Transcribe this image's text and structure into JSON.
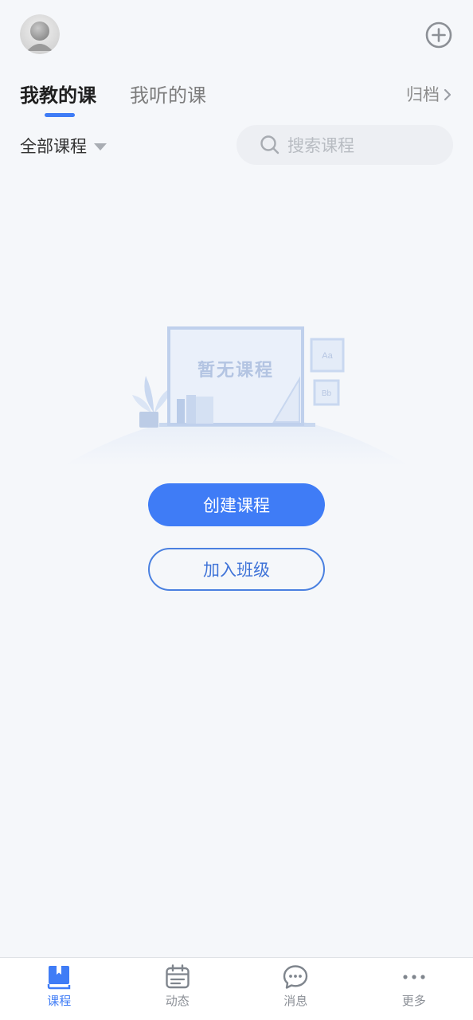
{
  "header": {
    "avatar": "avatar-placeholder-icon",
    "add_button": "plus-circle-icon"
  },
  "tabs": [
    {
      "label": "我教的课",
      "active": true
    },
    {
      "label": "我听的课",
      "active": false
    }
  ],
  "archive": {
    "label": "归档",
    "icon": "chevron-right-icon"
  },
  "filter": {
    "label": "全部课程",
    "icon": "caret-down-icon"
  },
  "search": {
    "placeholder": "搜索课程",
    "icon": "search-icon"
  },
  "empty_state": {
    "text": "暂无课程",
    "card_labels": [
      "Aa",
      "Bb"
    ]
  },
  "actions": {
    "create_course": "创建课程",
    "join_class": "加入班级"
  },
  "bottom_nav": [
    {
      "label": "课程",
      "icon": "book-icon",
      "active": true
    },
    {
      "label": "动态",
      "icon": "calendar-icon",
      "active": false
    },
    {
      "label": "消息",
      "icon": "chat-bubble-icon",
      "active": false
    },
    {
      "label": "更多",
      "icon": "more-dots-icon",
      "active": false
    }
  ],
  "colors": {
    "accent": "#3f7cf6",
    "background": "#f5f7fa",
    "nav_inactive": "#8b8f96"
  }
}
